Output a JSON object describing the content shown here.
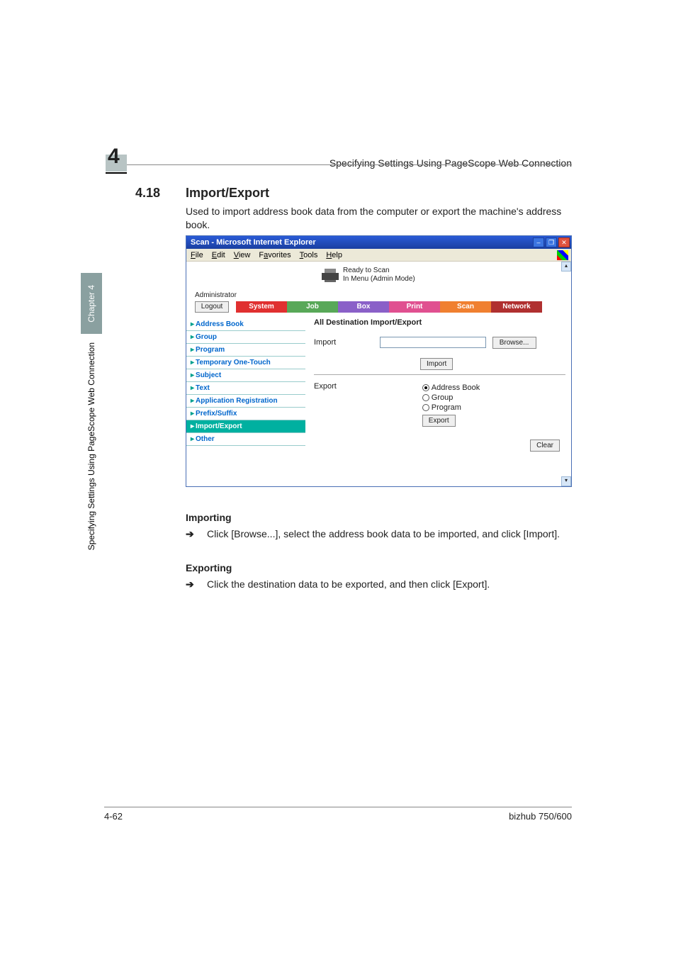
{
  "header": {
    "chapter_number": "4",
    "headline": "Specifying Settings Using PageScope Web Connection"
  },
  "section": {
    "number": "4.18",
    "title": "Import/Export",
    "description": "Used to import address book data from the computer or export the machine's address book."
  },
  "screenshot": {
    "window_title": "Scan - Microsoft Internet Explorer",
    "menus": {
      "file": "File",
      "edit": "Edit",
      "view": "View",
      "favorites": "Favorites",
      "tools": "Tools",
      "help": "Help"
    },
    "status": {
      "line1": "Ready to Scan",
      "line2": "In Menu (Admin Mode)"
    },
    "admin_label": "Administrator",
    "logout_label": "Logout",
    "tabs": {
      "system": "System",
      "job": "Job",
      "box": "Box",
      "print": "Print",
      "scan": "Scan",
      "network": "Network"
    },
    "sidebar": [
      "Address Book",
      "Group",
      "Program",
      "Temporary One-Touch",
      "Subject",
      "Text",
      "Application Registration",
      "Prefix/Suffix",
      "Import/Export",
      "Other"
    ],
    "main": {
      "title": "All Destination Import/Export",
      "import_label": "Import",
      "browse_label": "Browse...",
      "import_button": "Import",
      "export_label": "Export",
      "radios": {
        "address_book": "Address Book",
        "group": "Group",
        "program": "Program"
      },
      "export_button": "Export",
      "clear_button": "Clear"
    }
  },
  "importing": {
    "heading": "Importing",
    "arrow": "➔",
    "text": "Click [Browse...], select the address book data to be imported, and click [Import]."
  },
  "exporting": {
    "heading": "Exporting",
    "arrow": "➔",
    "text": "Click the destination data to be exported, and then click [Export]."
  },
  "sidetab": {
    "chapter": "Chapter 4",
    "label": "Specifying Settings Using PageScope Web Connection"
  },
  "footer": {
    "page": "4-62",
    "model": "bizhub 750/600"
  }
}
